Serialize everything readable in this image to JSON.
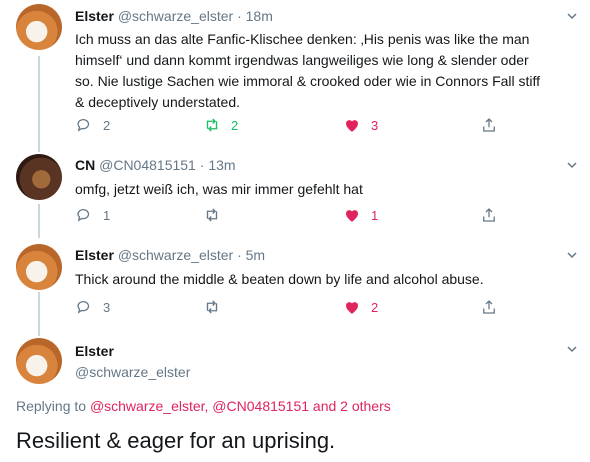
{
  "tweets": [
    {
      "name": "Elster",
      "handle": "@schwarze_elster",
      "dot": "·",
      "time": "18m",
      "lines": [
        "Ich muss an das alte Fanfic-Klischee denken: ‚His penis was like the man",
        "himself‘ und dann kommt irgendwas langweiliges wie long & slender oder",
        "so. Nie lustige Sachen wie immoral & crooked oder wie in Connors Fall stiff",
        "& deceptively understated."
      ],
      "replies": "2",
      "retweets": "2",
      "likes": "3"
    },
    {
      "name": "CN",
      "handle": "@CN04815151",
      "dot": "·",
      "time": "13m",
      "lines": [
        "omfg, jetzt weiß ich, was mir immer gefehlt hat"
      ],
      "replies": "1",
      "retweets": "",
      "likes": "1"
    },
    {
      "name": "Elster",
      "handle": "@schwarze_elster",
      "dot": "·",
      "time": "5m",
      "lines": [
        "Thick around the middle & beaten down by life and alcohol abuse."
      ],
      "replies": "3",
      "retweets": "",
      "likes": "2"
    }
  ],
  "main": {
    "name": "Elster",
    "handle": "@schwarze_elster",
    "replying_prefix": "Replying to",
    "replying_targets": "@schwarze_elster, @CN04815151 and 2 others",
    "text": "Resilient & eager for an uprising."
  },
  "colors": {
    "like": "#e0245e",
    "retweet": "#17bf63",
    "muted": "#657786",
    "link": "#e0245e"
  },
  "icons": [
    "reply-icon",
    "retweet-icon",
    "heart-icon",
    "share-icon",
    "chevron-down-icon"
  ]
}
